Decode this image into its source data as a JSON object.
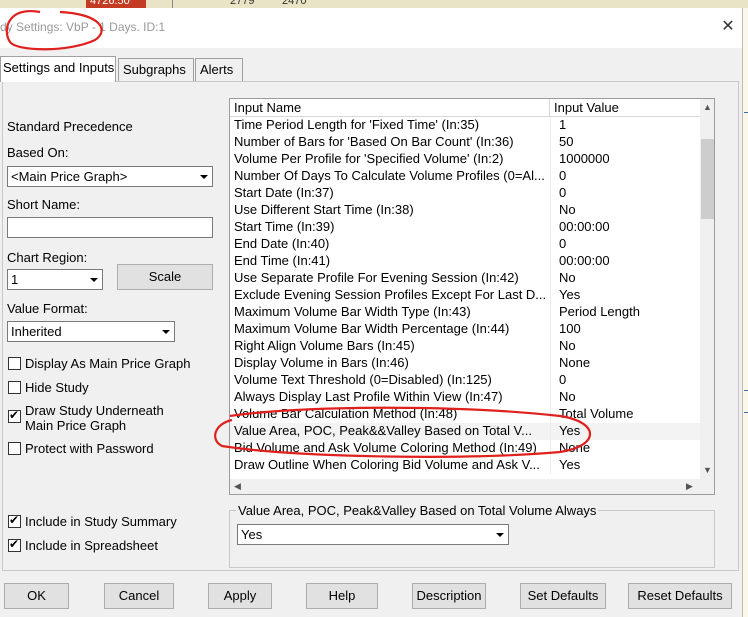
{
  "background_chart": {
    "price_tag": "4726.50",
    "values_left": "2779",
    "values_right": "2470"
  },
  "window": {
    "title": "dy Settings: VbP - 1 Days. ID:1",
    "close_glyph": "✕"
  },
  "tabs": [
    {
      "label": "Settings and Inputs",
      "active": true
    },
    {
      "label": "Subgraphs",
      "active": false
    },
    {
      "label": "Alerts",
      "active": false
    }
  ],
  "left": {
    "standard_precedence": "Standard Precedence",
    "based_on_label": "Based On:",
    "based_on_value": "<Main Price Graph>",
    "short_name_label": "Short Name:",
    "short_name_value": "",
    "chart_region_label": "Chart Region:",
    "chart_region_value": "1",
    "scale_button": "Scale",
    "value_format_label": "Value Format:",
    "value_format_value": "Inherited",
    "checkboxes": [
      {
        "label": "Display As Main Price Graph",
        "checked": false
      },
      {
        "label": "Hide Study",
        "checked": false
      },
      {
        "label": "Draw Study Underneath",
        "label2": "Main Price Graph",
        "checked": true
      },
      {
        "label": "Protect with Password",
        "checked": false
      },
      {
        "label": "Include in Study Summary",
        "checked": true
      },
      {
        "label": "Include in Spreadsheet",
        "checked": true
      }
    ]
  },
  "grid": {
    "col_name": "Input Name",
    "col_value": "Input Value",
    "rows": [
      {
        "name": "Time Period Length for 'Fixed Time'  (In:35)",
        "value": "1"
      },
      {
        "name": "Number of Bars for 'Based On Bar Count'  (In:36)",
        "value": "50"
      },
      {
        "name": "Volume Per Profile for 'Specified Volume'  (In:2)",
        "value": "1000000"
      },
      {
        "name": "Number Of Days To Calculate Volume Profiles (0=Al...",
        "value": "0"
      },
      {
        "name": "Start Date  (In:37)",
        "value": "0"
      },
      {
        "name": "Use Different Start Time  (In:38)",
        "value": "No"
      },
      {
        "name": "Start Time  (In:39)",
        "value": "00:00:00"
      },
      {
        "name": "End Date  (In:40)",
        "value": "0"
      },
      {
        "name": "End Time  (In:41)",
        "value": "00:00:00"
      },
      {
        "name": "Use Separate Profile For Evening Session  (In:42)",
        "value": "No"
      },
      {
        "name": "Exclude Evening Session Profiles Except For Last D...",
        "value": "Yes"
      },
      {
        "name": "Maximum Volume Bar Width Type  (In:43)",
        "value": "Period Length"
      },
      {
        "name": "Maximum Volume Bar Width Percentage  (In:44)",
        "value": "100"
      },
      {
        "name": "Right Align Volume Bars  (In:45)",
        "value": "No"
      },
      {
        "name": "Display Volume in Bars  (In:46)",
        "value": "None"
      },
      {
        "name": "Volume Text Threshold (0=Disabled)  (In:125)",
        "value": "0"
      },
      {
        "name": "Always Display Last Profile Within View  (In:47)",
        "value": "No"
      },
      {
        "name": "Volume Bar Calculation Method  (In:48)",
        "value": "Total Volume"
      },
      {
        "name": "Value Area, POC, Peak&&Valley Based on Total V...",
        "value": "Yes"
      },
      {
        "name": "Bid Volume and Ask Volume Coloring Method  (In:49)",
        "value": "None"
      },
      {
        "name": "Draw Outline When Coloring Bid Volume and Ask V...",
        "value": "Yes"
      }
    ],
    "selected_row": 18
  },
  "detail": {
    "title": "Value Area, POC, Peak&Valley Based on Total Volume Always",
    "value": "Yes"
  },
  "buttons": [
    "OK",
    "Cancel",
    "Apply",
    "Help",
    "Description",
    "Set Defaults",
    "Reset Defaults"
  ],
  "colors": {
    "annotation_red": "#e0201c",
    "accent_price": "#c23b22"
  }
}
